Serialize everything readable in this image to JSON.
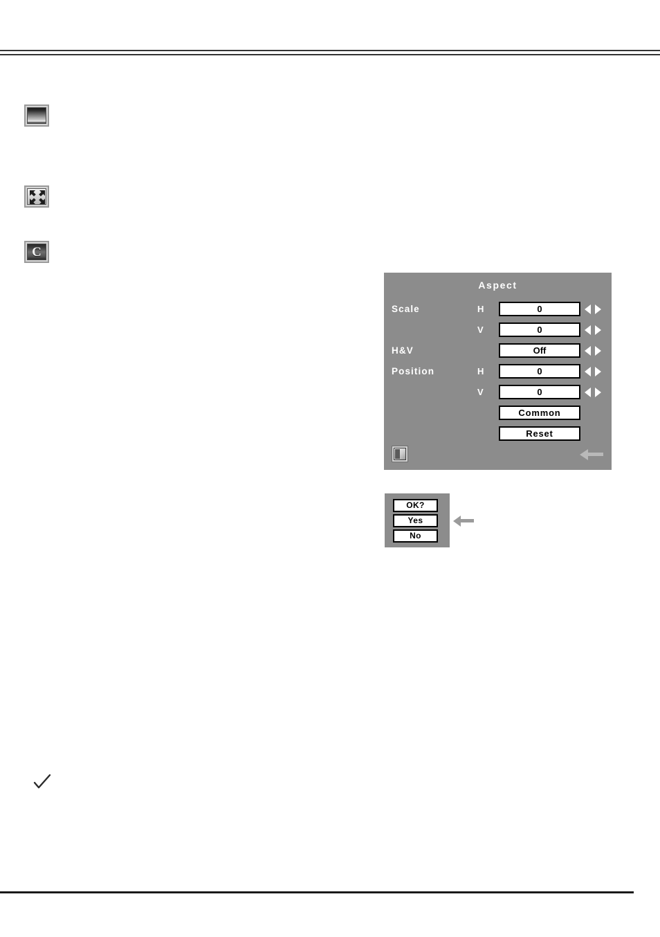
{
  "page": {
    "background_color": "#ffffff",
    "rule_color": "#333333",
    "bottom_rule_color": "#1a1a1a"
  },
  "margin_icons": [
    {
      "name": "screen-icon",
      "label": "Screen",
      "glyph": ""
    },
    {
      "name": "digital-zoom-icon",
      "label": "Digital zoom",
      "glyph": ""
    },
    {
      "name": "custom-icon",
      "label": "Custom",
      "glyph": "C"
    }
  ],
  "aspect_dialog": {
    "title": "Aspect",
    "background_color": "#8c8c8c",
    "text_color": "#ffffff",
    "rows": [
      {
        "label": "Scale",
        "sub": "H",
        "value": "0",
        "control": "spinner"
      },
      {
        "label": "",
        "sub": "V",
        "value": "0",
        "control": "spinner"
      },
      {
        "label": "H&V",
        "sub": "",
        "value": "Off",
        "control": "spinner"
      },
      {
        "label": "Position",
        "sub": "H",
        "value": "0",
        "control": "spinner"
      },
      {
        "label": "",
        "sub": "V",
        "value": "0",
        "control": "spinner"
      }
    ],
    "buttons": [
      {
        "label": "Common"
      },
      {
        "label": "Reset"
      }
    ],
    "exit_icon": "exit-door-icon",
    "back_arrow": "back-arrow-icon"
  },
  "confirm_dialog": {
    "background_color": "#8c8c8c",
    "buttons": [
      {
        "label": "OK?"
      },
      {
        "label": "Yes"
      },
      {
        "label": "No"
      }
    ],
    "pointer_icon": "left-arrow-pointer-icon"
  },
  "note": {
    "marker": "checkmark-icon"
  }
}
